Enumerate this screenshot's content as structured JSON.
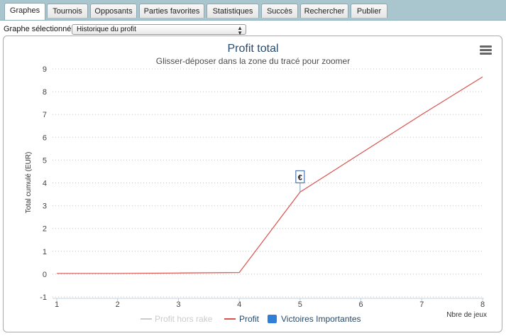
{
  "tabs": [
    {
      "label": "Graphes",
      "active": true
    },
    {
      "label": "Tournois",
      "active": false
    },
    {
      "label": "Opposants",
      "active": false
    },
    {
      "label": "Parties favorites",
      "active": false
    },
    {
      "label": "Statistiques",
      "active": false
    },
    {
      "label": "Succès",
      "active": false
    },
    {
      "label": "Rechercher",
      "active": false
    },
    {
      "label": "Publier",
      "active": false
    }
  ],
  "graph_select": {
    "label": "Graphe sélectionné :",
    "value": "Historique du profit"
  },
  "colors": {
    "profit_line": "#d9534f",
    "rake_line": "#cccccc",
    "victory_marker": "#2f7ed8",
    "title": "#274b6d"
  },
  "menu_icon": "hamburger-menu-icon",
  "chart_data": {
    "type": "line",
    "title": "Profit total",
    "subtitle": "Glisser-déposer dans la zone du tracé pour zoomer",
    "xlabel": "Nbre de jeux",
    "ylabel": "Total cumulé (EUR)",
    "xlim": [
      1,
      8
    ],
    "ylim": [
      -1,
      9
    ],
    "x_ticks": [
      1,
      2,
      3,
      4,
      5,
      6,
      7,
      8
    ],
    "y_ticks": [
      -1,
      0,
      1,
      2,
      3,
      4,
      5,
      6,
      7,
      8,
      9
    ],
    "grid": "horizontal-dotted",
    "legend_position": "bottom-center",
    "series": [
      {
        "name": "Profit hors rake",
        "x": [],
        "y": [],
        "visible": false
      },
      {
        "name": "Profit",
        "x": [
          1,
          2,
          3,
          4,
          5,
          6,
          7,
          8
        ],
        "y": [
          0.03,
          0.03,
          0.05,
          0.07,
          3.6,
          5.3,
          7.0,
          8.65
        ]
      },
      {
        "name": "Victoires Importantes",
        "x": [
          5
        ],
        "y": [
          3.6
        ]
      }
    ],
    "annotations": [
      {
        "x": 5,
        "y": 3.6,
        "label": "€"
      }
    ]
  }
}
